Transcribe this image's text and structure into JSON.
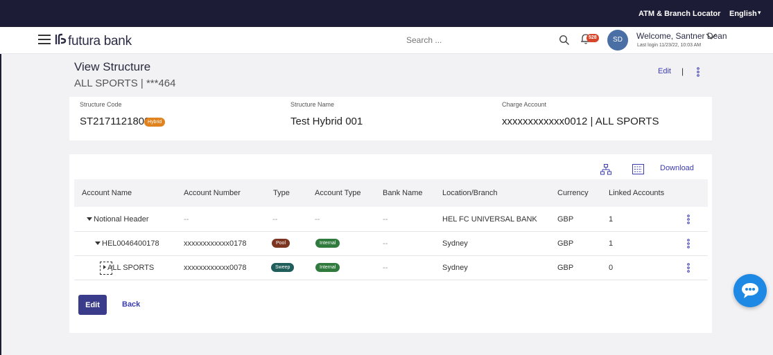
{
  "topbar": {
    "atm_locator": "ATM & Branch Locator",
    "language": "English"
  },
  "header": {
    "brand": "futura bank",
    "search_placeholder": "Search ...",
    "notification_count": "528",
    "avatar_initials": "SD",
    "welcome": "Welcome, Santner Dean",
    "last_login": "Last login 11/23/22, 10:03 AM"
  },
  "page": {
    "title": "View Structure",
    "subtitle": "ALL SPORTS | ***464",
    "edit_link": "Edit",
    "separator": "|"
  },
  "summary": {
    "structure_code_label": "Structure Code",
    "structure_code": "ST2171121809",
    "structure_badge": "Hybrid",
    "structure_name_label": "Structure Name",
    "structure_name": "Test Hybrid 001",
    "charge_account_label": "Charge Account",
    "charge_account": "xxxxxxxxxxxx0012 | ALL SPORTS"
  },
  "toolbar": {
    "download": "Download"
  },
  "table": {
    "headers": [
      "Account Name",
      "Account Number",
      "Type",
      "Account Type",
      "Bank Name",
      "Location/Branch",
      "Currency",
      "Linked Accounts"
    ],
    "rows": [
      {
        "name": "Notional Header",
        "number": "--",
        "type": "--",
        "account_type": "--",
        "bank": "--",
        "location": "HEL FC UNIVERSAL BANK",
        "currency": "GBP",
        "linked": "1"
      },
      {
        "name": "HEL0046400178",
        "number": "xxxxxxxxxxxx0178",
        "type": "Pool",
        "account_type": "Internal",
        "bank": "--",
        "location": "Sydney",
        "currency": "GBP",
        "linked": "1"
      },
      {
        "name": "ALL SPORTS",
        "number": "xxxxxxxxxxxx0078",
        "type": "Sweep",
        "account_type": "Internal",
        "bank": "--",
        "location": "Sydney",
        "currency": "GBP",
        "linked": "0"
      }
    ]
  },
  "actions": {
    "edit": "Edit",
    "back": "Back"
  },
  "colors": {
    "topbar": "#1d1c36",
    "primary_button": "#3a3b8b",
    "link": "#3b3bb0",
    "hybrid_badge": "#e0821e",
    "pool_pill": "#7b3521",
    "sweep_pill": "#1f5e5a",
    "internal_pill": "#2f7a3c",
    "chat_fab": "#1e88e5"
  },
  "icons": [
    "hamburger-icon",
    "bank-logo-icon",
    "search-icon",
    "bell-icon",
    "chevron-down-icon",
    "kebab-icon",
    "tree-view-icon",
    "grid-view-icon",
    "chat-icon"
  ]
}
